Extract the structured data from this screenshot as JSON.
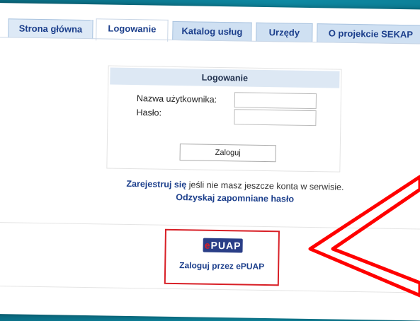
{
  "nav": {
    "home": "Strona główna",
    "login": "Logowanie",
    "services": "Katalog usług",
    "offices": "Urzędy",
    "about": "O projekcie SEKAP"
  },
  "login": {
    "title": "Logowanie",
    "username_label": "Nazwa użytkownika:",
    "password_label": "Hasło:",
    "username_value": "",
    "password_value": "",
    "submit": "Zaloguj"
  },
  "register": {
    "link": "Zarejestruj się",
    "text": " jeśli nie masz jeszcze konta w serwisie."
  },
  "forgot": "Odzyskaj zapomniane hasło",
  "epuap": {
    "logo": "ePUAP",
    "label": "Zaloguj przez ePUAP"
  },
  "colors": {
    "accent": "#1c3f8c",
    "highlight": "#d81f26",
    "background": "#0e8aa3"
  }
}
